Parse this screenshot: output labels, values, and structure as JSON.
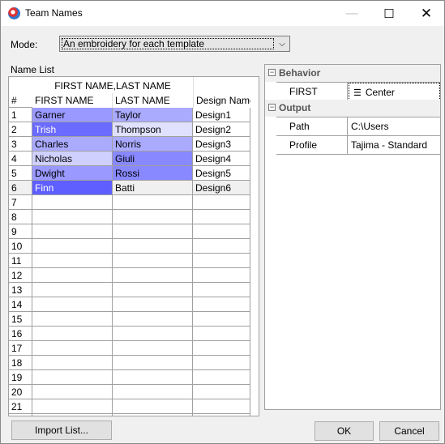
{
  "window": {
    "title": "Team Names"
  },
  "mode": {
    "label": "Mode:",
    "value": "An embroidery for each template"
  },
  "name_list": {
    "label": "Name List",
    "group_header": "FIRST NAME,LAST NAME",
    "columns": [
      "#",
      "FIRST NAME",
      "LAST NAME",
      "Design Name"
    ],
    "rows": [
      {
        "n": "1",
        "first": "Garner",
        "last": "Taylor",
        "design": "Design1",
        "first_color": "#9999ff",
        "last_color": "#aaaaff"
      },
      {
        "n": "2",
        "first": "Trish",
        "last": "Thompson",
        "design": "Design2",
        "first_color": "#6b6bff",
        "last_color": "#e0e0ff"
      },
      {
        "n": "3",
        "first": "Charles",
        "last": "Norris",
        "design": "Design3",
        "first_color": "#aaaaff",
        "last_color": "#aaaaff"
      },
      {
        "n": "4",
        "first": "Nicholas",
        "last": "Giuli",
        "design": "Design4",
        "first_color": "#d0d0ff",
        "last_color": "#8888ff"
      },
      {
        "n": "5",
        "first": "Dwight",
        "last": "Rossi",
        "design": "Design5",
        "first_color": "#9999ff",
        "last_color": "#8888ff"
      },
      {
        "n": "6",
        "first": "Finn",
        "last": "Batti",
        "design": "Design6",
        "first_color": "#5f5fff",
        "last_color": "#f0f0f0"
      },
      {
        "n": "7"
      },
      {
        "n": "8"
      },
      {
        "n": "9"
      },
      {
        "n": "10"
      },
      {
        "n": "11"
      },
      {
        "n": "12"
      },
      {
        "n": "13"
      },
      {
        "n": "14"
      },
      {
        "n": "15"
      },
      {
        "n": "16"
      },
      {
        "n": "17"
      },
      {
        "n": "18"
      },
      {
        "n": "19"
      },
      {
        "n": "20"
      },
      {
        "n": "21"
      }
    ]
  },
  "properties": {
    "behavior": {
      "label": "Behavior",
      "items": [
        {
          "key": "FIRST NAME.",
          "value": "Center",
          "icon": "align-center-icon"
        }
      ]
    },
    "output": {
      "label": "Output",
      "items": [
        {
          "key": "Path",
          "value": "C:\\Users"
        },
        {
          "key": "Profile",
          "value": "Tajima - Standard"
        }
      ]
    }
  },
  "buttons": {
    "import": "Import List...",
    "ok": "OK",
    "cancel": "Cancel"
  }
}
